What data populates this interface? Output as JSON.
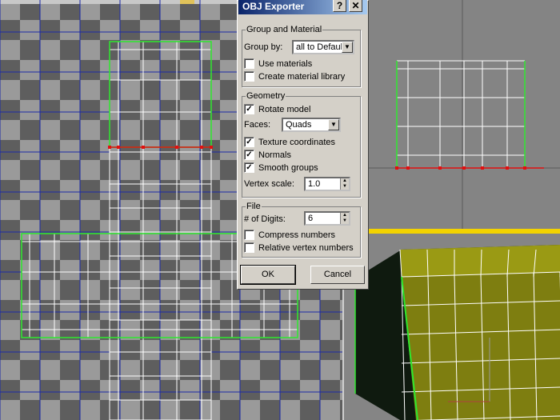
{
  "dialog": {
    "title": "OBJ Exporter",
    "help_label": "?",
    "close_label": "X",
    "group_material": {
      "legend": "Group and Material",
      "group_by_label": "Group by:",
      "group_by_value": "all to Defaul",
      "use_materials": {
        "label": "Use materials",
        "checked": false
      },
      "create_material_library": {
        "label": "Create material library",
        "checked": false
      }
    },
    "geometry": {
      "legend": "Geometry",
      "rotate_model": {
        "label": "Rotate model",
        "checked": true
      },
      "faces_label": "Faces:",
      "faces_value": "Quads",
      "texture_coordinates": {
        "label": "Texture coordinates",
        "checked": true
      },
      "normals": {
        "label": "Normals",
        "checked": true
      },
      "smooth_groups": {
        "label": "Smooth groups",
        "checked": true
      },
      "vertex_scale_label": "Vertex scale:",
      "vertex_scale_value": "1.0"
    },
    "file": {
      "legend": "File",
      "digits_label": "# of Digits:",
      "digits_value": "6",
      "compress_numbers": {
        "label": "Compress numbers",
        "checked": false
      },
      "relative_vertex_numbers": {
        "label": "Relative vertex numbers",
        "checked": false
      }
    },
    "ok_label": "OK",
    "cancel_label": "Cancel"
  },
  "colors": {
    "titlebar_start": "#0a246a",
    "dialog_bg": "#d4d0c8",
    "viewport_divider": "#f3d300",
    "mesh_wire": "#ffffff",
    "uv_grid_lines": "#1c2aa8",
    "selection_edge": "#2ee82e",
    "vertex_marker": "#e01010",
    "cube_face": "#7e7e10"
  },
  "icons": {
    "help": "question-mark-icon",
    "close": "close-x-icon",
    "dropdown": "chevron-down-icon",
    "spinner": "spinner-arrows-icon"
  }
}
